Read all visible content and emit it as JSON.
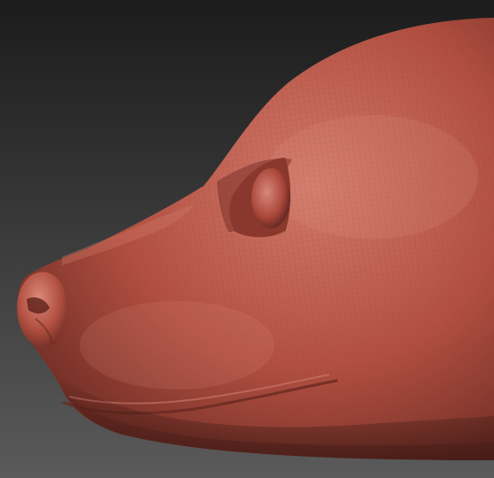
{
  "viewport": {
    "background_top": "#1c1c1c",
    "background_bottom": "#5a5a5a"
  },
  "model": {
    "material_base": "#b14f41",
    "material_highlight": "#d27a6a",
    "material_shadow": "#6a2a22",
    "wireframe_color": "#8e3a30",
    "wireframe_visible": true
  }
}
